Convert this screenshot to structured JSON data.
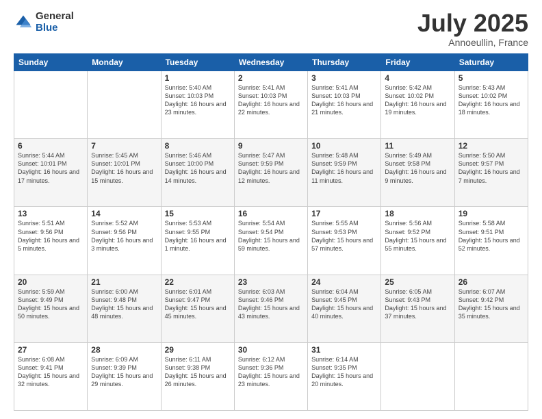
{
  "logo": {
    "general": "General",
    "blue": "Blue"
  },
  "title": "July 2025",
  "location": "Annoeullin, France",
  "days_of_week": [
    "Sunday",
    "Monday",
    "Tuesday",
    "Wednesday",
    "Thursday",
    "Friday",
    "Saturday"
  ],
  "weeks": [
    [
      {
        "day": "",
        "sunrise": "",
        "sunset": "",
        "daylight": ""
      },
      {
        "day": "",
        "sunrise": "",
        "sunset": "",
        "daylight": ""
      },
      {
        "day": "1",
        "sunrise": "Sunrise: 5:40 AM",
        "sunset": "Sunset: 10:03 PM",
        "daylight": "Daylight: 16 hours and 23 minutes."
      },
      {
        "day": "2",
        "sunrise": "Sunrise: 5:41 AM",
        "sunset": "Sunset: 10:03 PM",
        "daylight": "Daylight: 16 hours and 22 minutes."
      },
      {
        "day": "3",
        "sunrise": "Sunrise: 5:41 AM",
        "sunset": "Sunset: 10:03 PM",
        "daylight": "Daylight: 16 hours and 21 minutes."
      },
      {
        "day": "4",
        "sunrise": "Sunrise: 5:42 AM",
        "sunset": "Sunset: 10:02 PM",
        "daylight": "Daylight: 16 hours and 19 minutes."
      },
      {
        "day": "5",
        "sunrise": "Sunrise: 5:43 AM",
        "sunset": "Sunset: 10:02 PM",
        "daylight": "Daylight: 16 hours and 18 minutes."
      }
    ],
    [
      {
        "day": "6",
        "sunrise": "Sunrise: 5:44 AM",
        "sunset": "Sunset: 10:01 PM",
        "daylight": "Daylight: 16 hours and 17 minutes."
      },
      {
        "day": "7",
        "sunrise": "Sunrise: 5:45 AM",
        "sunset": "Sunset: 10:01 PM",
        "daylight": "Daylight: 16 hours and 15 minutes."
      },
      {
        "day": "8",
        "sunrise": "Sunrise: 5:46 AM",
        "sunset": "Sunset: 10:00 PM",
        "daylight": "Daylight: 16 hours and 14 minutes."
      },
      {
        "day": "9",
        "sunrise": "Sunrise: 5:47 AM",
        "sunset": "Sunset: 9:59 PM",
        "daylight": "Daylight: 16 hours and 12 minutes."
      },
      {
        "day": "10",
        "sunrise": "Sunrise: 5:48 AM",
        "sunset": "Sunset: 9:59 PM",
        "daylight": "Daylight: 16 hours and 11 minutes."
      },
      {
        "day": "11",
        "sunrise": "Sunrise: 5:49 AM",
        "sunset": "Sunset: 9:58 PM",
        "daylight": "Daylight: 16 hours and 9 minutes."
      },
      {
        "day": "12",
        "sunrise": "Sunrise: 5:50 AM",
        "sunset": "Sunset: 9:57 PM",
        "daylight": "Daylight: 16 hours and 7 minutes."
      }
    ],
    [
      {
        "day": "13",
        "sunrise": "Sunrise: 5:51 AM",
        "sunset": "Sunset: 9:56 PM",
        "daylight": "Daylight: 16 hours and 5 minutes."
      },
      {
        "day": "14",
        "sunrise": "Sunrise: 5:52 AM",
        "sunset": "Sunset: 9:56 PM",
        "daylight": "Daylight: 16 hours and 3 minutes."
      },
      {
        "day": "15",
        "sunrise": "Sunrise: 5:53 AM",
        "sunset": "Sunset: 9:55 PM",
        "daylight": "Daylight: 16 hours and 1 minute."
      },
      {
        "day": "16",
        "sunrise": "Sunrise: 5:54 AM",
        "sunset": "Sunset: 9:54 PM",
        "daylight": "Daylight: 15 hours and 59 minutes."
      },
      {
        "day": "17",
        "sunrise": "Sunrise: 5:55 AM",
        "sunset": "Sunset: 9:53 PM",
        "daylight": "Daylight: 15 hours and 57 minutes."
      },
      {
        "day": "18",
        "sunrise": "Sunrise: 5:56 AM",
        "sunset": "Sunset: 9:52 PM",
        "daylight": "Daylight: 15 hours and 55 minutes."
      },
      {
        "day": "19",
        "sunrise": "Sunrise: 5:58 AM",
        "sunset": "Sunset: 9:51 PM",
        "daylight": "Daylight: 15 hours and 52 minutes."
      }
    ],
    [
      {
        "day": "20",
        "sunrise": "Sunrise: 5:59 AM",
        "sunset": "Sunset: 9:49 PM",
        "daylight": "Daylight: 15 hours and 50 minutes."
      },
      {
        "day": "21",
        "sunrise": "Sunrise: 6:00 AM",
        "sunset": "Sunset: 9:48 PM",
        "daylight": "Daylight: 15 hours and 48 minutes."
      },
      {
        "day": "22",
        "sunrise": "Sunrise: 6:01 AM",
        "sunset": "Sunset: 9:47 PM",
        "daylight": "Daylight: 15 hours and 45 minutes."
      },
      {
        "day": "23",
        "sunrise": "Sunrise: 6:03 AM",
        "sunset": "Sunset: 9:46 PM",
        "daylight": "Daylight: 15 hours and 43 minutes."
      },
      {
        "day": "24",
        "sunrise": "Sunrise: 6:04 AM",
        "sunset": "Sunset: 9:45 PM",
        "daylight": "Daylight: 15 hours and 40 minutes."
      },
      {
        "day": "25",
        "sunrise": "Sunrise: 6:05 AM",
        "sunset": "Sunset: 9:43 PM",
        "daylight": "Daylight: 15 hours and 37 minutes."
      },
      {
        "day": "26",
        "sunrise": "Sunrise: 6:07 AM",
        "sunset": "Sunset: 9:42 PM",
        "daylight": "Daylight: 15 hours and 35 minutes."
      }
    ],
    [
      {
        "day": "27",
        "sunrise": "Sunrise: 6:08 AM",
        "sunset": "Sunset: 9:41 PM",
        "daylight": "Daylight: 15 hours and 32 minutes."
      },
      {
        "day": "28",
        "sunrise": "Sunrise: 6:09 AM",
        "sunset": "Sunset: 9:39 PM",
        "daylight": "Daylight: 15 hours and 29 minutes."
      },
      {
        "day": "29",
        "sunrise": "Sunrise: 6:11 AM",
        "sunset": "Sunset: 9:38 PM",
        "daylight": "Daylight: 15 hours and 26 minutes."
      },
      {
        "day": "30",
        "sunrise": "Sunrise: 6:12 AM",
        "sunset": "Sunset: 9:36 PM",
        "daylight": "Daylight: 15 hours and 23 minutes."
      },
      {
        "day": "31",
        "sunrise": "Sunrise: 6:14 AM",
        "sunset": "Sunset: 9:35 PM",
        "daylight": "Daylight: 15 hours and 20 minutes."
      },
      {
        "day": "",
        "sunrise": "",
        "sunset": "",
        "daylight": ""
      },
      {
        "day": "",
        "sunrise": "",
        "sunset": "",
        "daylight": ""
      }
    ]
  ]
}
